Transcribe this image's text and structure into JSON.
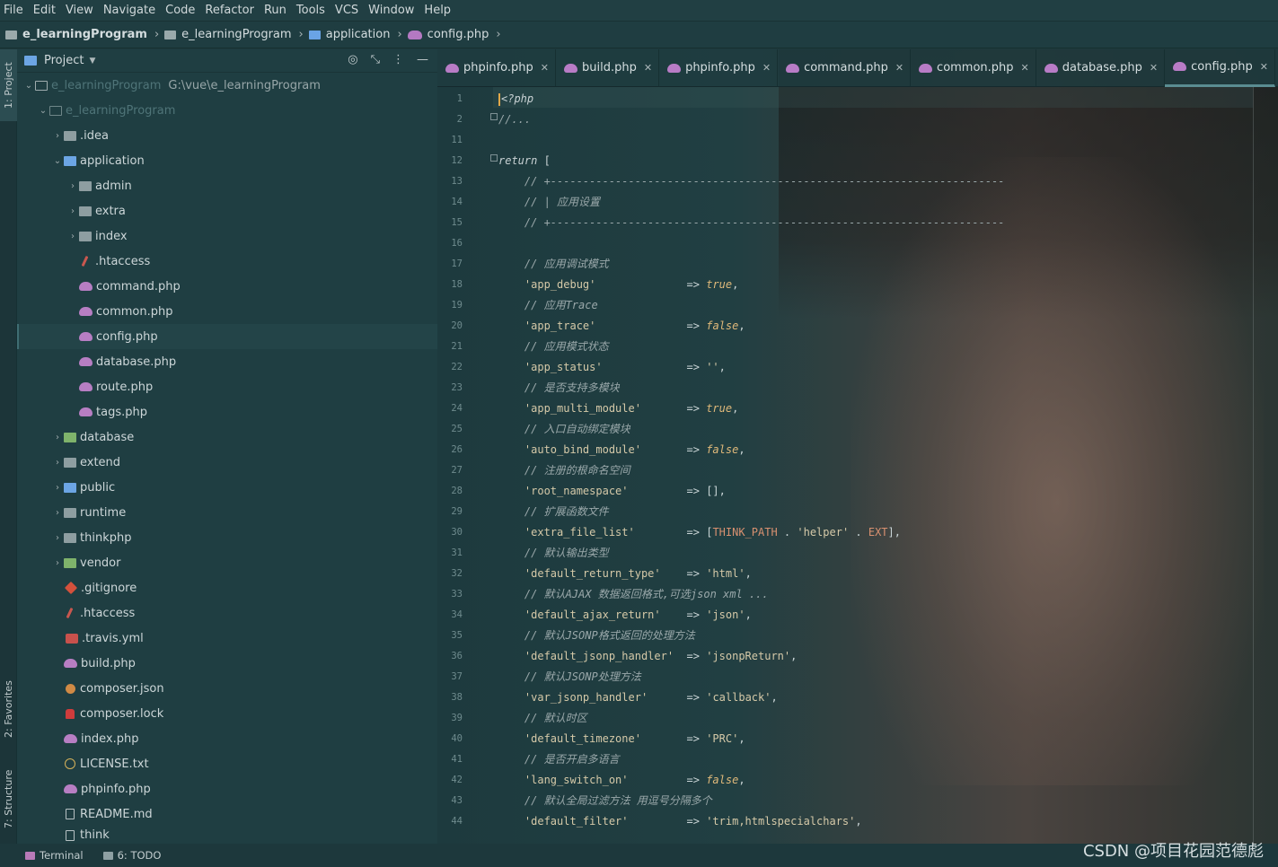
{
  "menu": [
    "File",
    "Edit",
    "View",
    "Navigate",
    "Code",
    "Refactor",
    "Run",
    "Tools",
    "VCS",
    "Window",
    "Help"
  ],
  "breadcrumb": [
    "e_learningProgram",
    "e_learningProgram",
    "application",
    "config.php"
  ],
  "side_tabs": {
    "project": "1: Project",
    "favorites": "2: Favorites",
    "structure": "7: Structure"
  },
  "project": {
    "title": "Project",
    "root_name": "e_learningProgram",
    "root_path": "G:\\vue\\e_learningProgram",
    "module_name": "e_learningProgram",
    "items": [
      ".idea",
      "application",
      "admin",
      "extra",
      "index",
      ".htaccess",
      "command.php",
      "common.php",
      "config.php",
      "database.php",
      "route.php",
      "tags.php",
      "database",
      "extend",
      "public",
      "runtime",
      "thinkphp",
      "vendor",
      ".gitignore",
      ".htaccess",
      ".travis.yml",
      "build.php",
      "composer.json",
      "composer.lock",
      "index.php",
      "LICENSE.txt",
      "phpinfo.php",
      "README.md",
      "think"
    ]
  },
  "tabs": [
    "phpinfo.php",
    "build.php",
    "phpinfo.php",
    "command.php",
    "common.php",
    "database.php",
    "config.php"
  ],
  "gutter": [
    "1",
    "2",
    "11",
    "12",
    "13",
    "14",
    "15",
    "16",
    "17",
    "18",
    "19",
    "20",
    "21",
    "22",
    "23",
    "24",
    "25",
    "26",
    "27",
    "28",
    "29",
    "30",
    "31",
    "32",
    "33",
    "34",
    "35",
    "36",
    "37",
    "38",
    "39",
    "40",
    "41",
    "42",
    "43",
    "44"
  ],
  "code": [
    "<?php",
    "//...",
    "",
    "return [",
    "    // +----------------------------------------------------------------------",
    "    // | 应用设置",
    "    // +----------------------------------------------------------------------",
    "",
    "    // 应用调试模式",
    "    'app_debug'              => true,",
    "    // 应用Trace",
    "    'app_trace'              => false,",
    "    // 应用模式状态",
    "    'app_status'             => '',",
    "    // 是否支持多模块",
    "    'app_multi_module'       => true,",
    "    // 入口自动绑定模块",
    "    'auto_bind_module'       => false,",
    "    // 注册的根命名空间",
    "    'root_namespace'         => [],",
    "    // 扩展函数文件",
    "    'extra_file_list'        => [THINK_PATH . 'helper' . EXT],",
    "    // 默认输出类型",
    "    'default_return_type'    => 'html',",
    "    // 默认AJAX 数据返回格式,可选json xml ...",
    "    'default_ajax_return'    => 'json',",
    "    // 默认JSONP格式返回的处理方法",
    "    'default_jsonp_handler'  => 'jsonpReturn',",
    "    // 默认JSONP处理方法",
    "    'var_jsonp_handler'      => 'callback',",
    "    // 默认时区",
    "    'default_timezone'       => 'PRC',",
    "    // 是否开启多语言",
    "    'lang_switch_on'         => false,",
    "    // 默认全局过滤方法 用逗号分隔多个",
    "    'default_filter'         => 'trim,htmlspecialchars',"
  ],
  "bottom": {
    "terminal": "Terminal",
    "todo": "6: TODO"
  },
  "watermark": "CSDN @项目花园范德彪"
}
